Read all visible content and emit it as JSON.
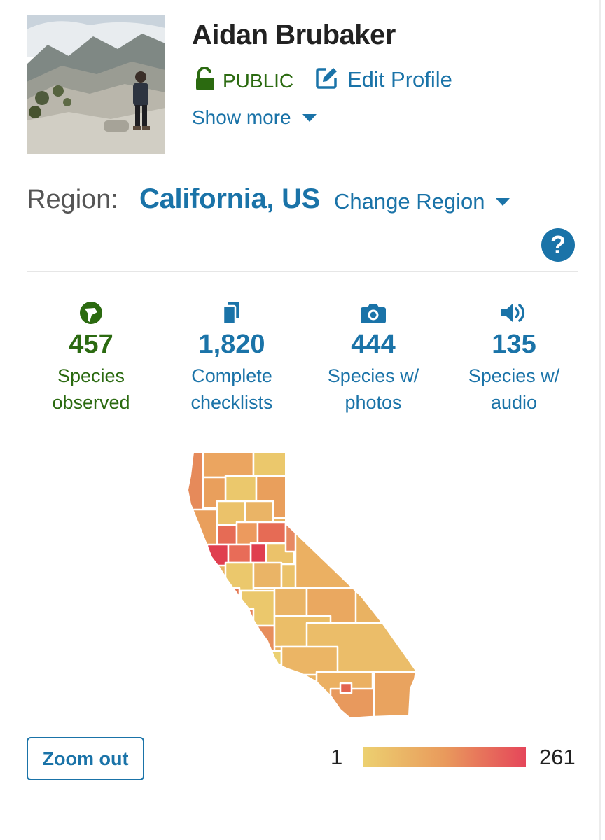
{
  "profile": {
    "name": "Aidan Brubaker",
    "visibility_label": "PUBLIC",
    "edit_label": "Edit Profile",
    "show_more_label": "Show more"
  },
  "region": {
    "label": "Region:",
    "name": "California, US",
    "change_label": "Change Region",
    "help_symbol": "?"
  },
  "stats": [
    {
      "icon": "bird-icon",
      "value": "457",
      "label_line1": "Species",
      "label_line2": "observed",
      "color": "#2b6a10"
    },
    {
      "icon": "checklists-icon",
      "value": "1,820",
      "label_line1": "Complete",
      "label_line2": "checklists",
      "color": "#1a73a8"
    },
    {
      "icon": "camera-icon",
      "value": "444",
      "label_line1": "Species w/",
      "label_line2": "photos",
      "color": "#1a73a8"
    },
    {
      "icon": "speaker-icon",
      "value": "135",
      "label_line1": "Species w/",
      "label_line2": "audio",
      "color": "#1a73a8"
    }
  ],
  "map": {
    "region_shown": "California counties",
    "legend_min": "1",
    "legend_max": "261",
    "color_low": "#ecd070",
    "color_high": "#e5465a"
  },
  "zoom_out_label": "Zoom out",
  "colors": {
    "accent_blue": "#1a73a8",
    "accent_green": "#2b6a10"
  }
}
